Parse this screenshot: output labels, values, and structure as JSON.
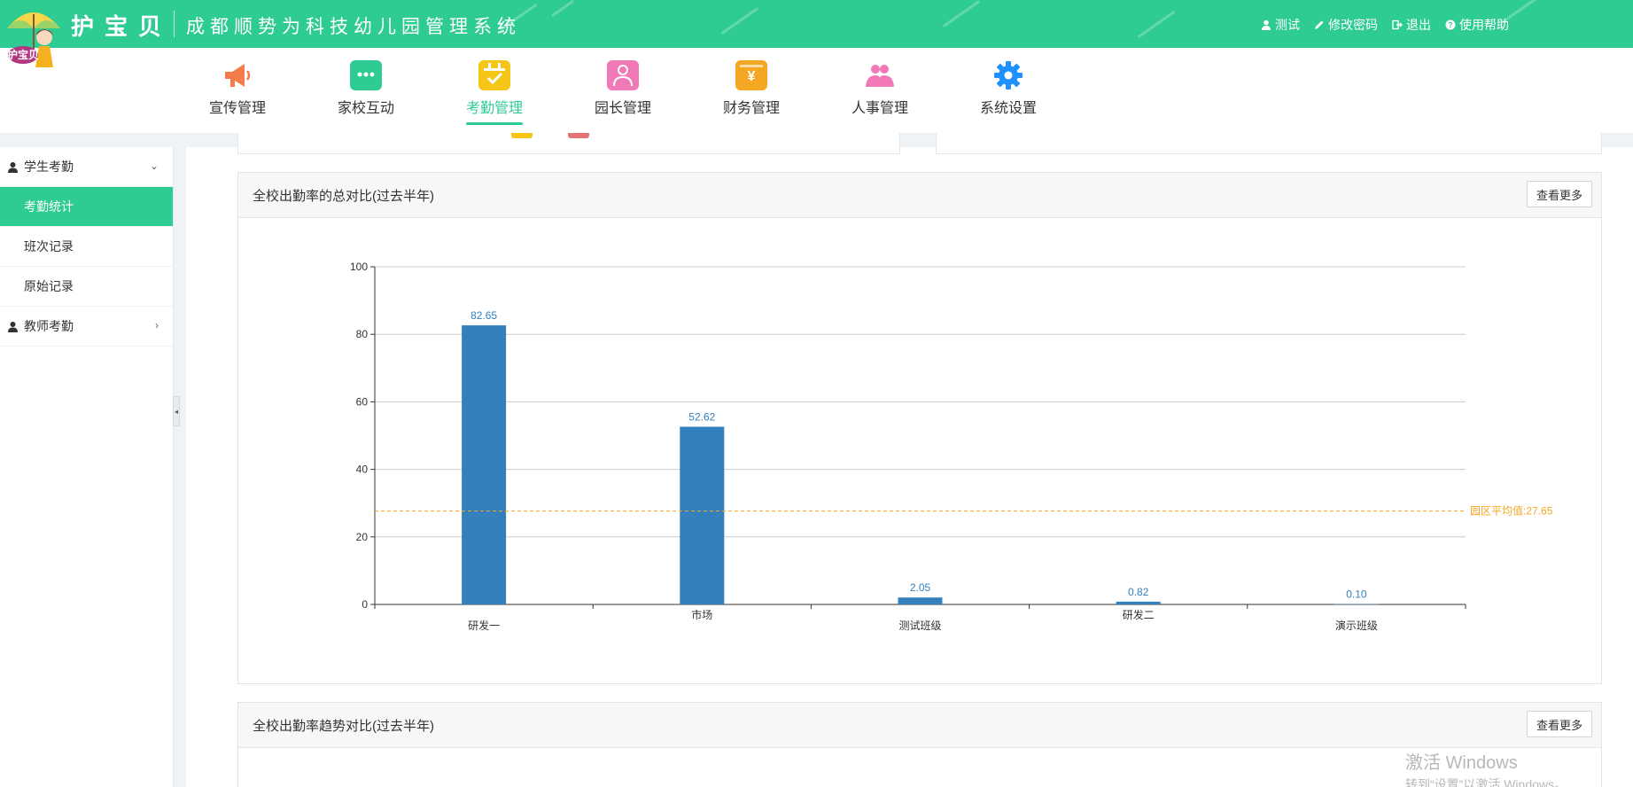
{
  "brand": {
    "name": "护宝贝",
    "system_title": "成都顺势为科技幼儿园管理系统",
    "logo_text": "护宝贝"
  },
  "top_actions": [
    {
      "label": "测试",
      "icon": "user-icon"
    },
    {
      "label": "修改密码",
      "icon": "pencil-icon"
    },
    {
      "label": "退出",
      "icon": "logout-icon"
    },
    {
      "label": "使用帮助",
      "icon": "help-icon"
    }
  ],
  "nav": [
    {
      "label": "宣传管理",
      "icon": "megaphone-icon",
      "color": "#f57b4a"
    },
    {
      "label": "家校互动",
      "icon": "chat-icon",
      "color": "#2ecb93"
    },
    {
      "label": "考勤管理",
      "icon": "calendar-check-icon",
      "color": "#f5c518",
      "active": true
    },
    {
      "label": "园长管理",
      "icon": "director-icon",
      "color": "#f279b8"
    },
    {
      "label": "财务管理",
      "icon": "yen-icon",
      "color": "#f5a623"
    },
    {
      "label": "人事管理",
      "icon": "people-icon",
      "color": "#f279b8"
    },
    {
      "label": "系统设置",
      "icon": "gear-icon",
      "color": "#1e90ff"
    }
  ],
  "sidebar": {
    "group_student": "学生考勤",
    "items": [
      "考勤统计",
      "班次记录",
      "原始记录"
    ],
    "group_teacher": "教师考勤"
  },
  "panels": {
    "chart1_title": "全校出勤率的总对比(过去半年)",
    "chart2_title": "全校出勤率趋势对比(过去半年)",
    "more_label": "查看更多"
  },
  "chart_data": {
    "type": "bar",
    "categories": [
      "研发一",
      "市场",
      "测试班级",
      "研发二",
      "演示班级"
    ],
    "values": [
      82.65,
      52.62,
      2.05,
      0.82,
      0.1
    ],
    "value_labels": [
      "82.65",
      "52.62",
      "2.05",
      "0.82",
      "0.10"
    ],
    "ylim": [
      0,
      100
    ],
    "yticks": [
      0,
      20,
      40,
      60,
      80,
      100
    ],
    "average": {
      "value": 27.65,
      "label": "园区平均值:27.65",
      "color": "#f5a623"
    },
    "bar_color": "#3380bd",
    "grid": true
  },
  "watermark": {
    "line1": "激活 Windows",
    "line2": "转到“设置”以激活 Windows。"
  }
}
